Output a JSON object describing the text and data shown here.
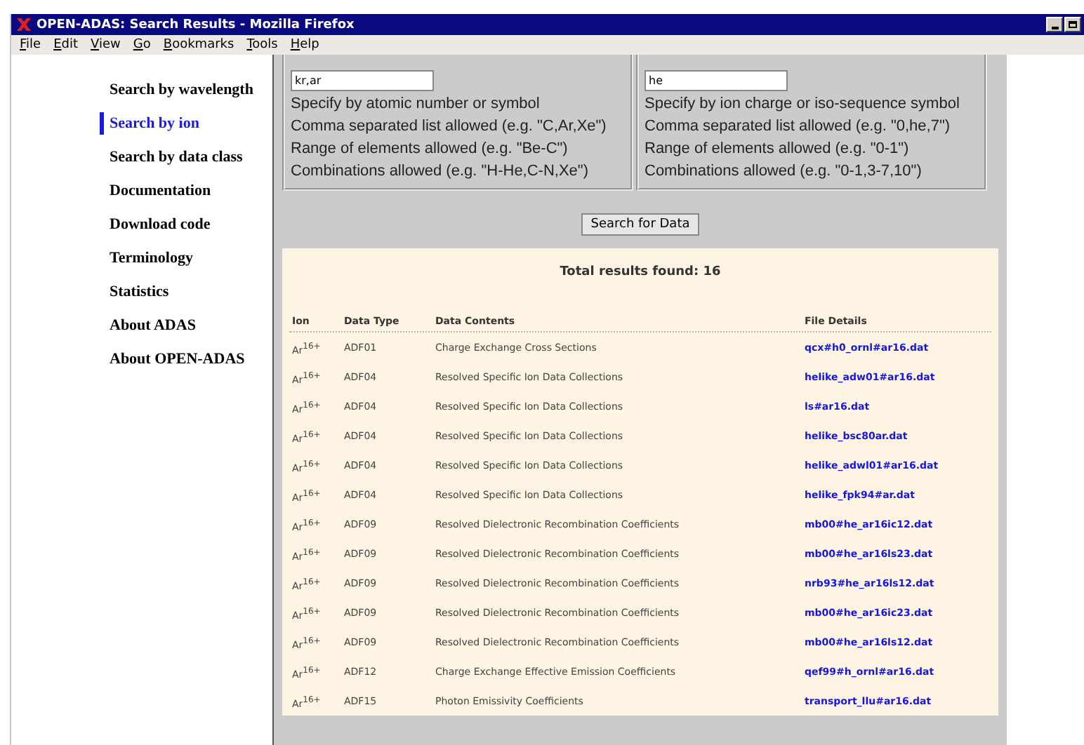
{
  "window": {
    "title": "OPEN-ADAS: Search Results - Mozilla Firefox"
  },
  "menu": [
    "File",
    "Edit",
    "View",
    "Go",
    "Bookmarks",
    "Tools",
    "Help"
  ],
  "sidebar": {
    "items": [
      {
        "label": "Search by wavelength",
        "selected": false
      },
      {
        "label": "Search by ion",
        "selected": true
      },
      {
        "label": "Search by data class",
        "selected": false
      },
      {
        "label": "Documentation",
        "selected": false
      },
      {
        "label": "Download code",
        "selected": false
      },
      {
        "label": "Terminology",
        "selected": false
      },
      {
        "label": "Statistics",
        "selected": false
      },
      {
        "label": "About ADAS",
        "selected": false
      },
      {
        "label": "About OPEN-ADAS",
        "selected": false
      }
    ]
  },
  "search_form": {
    "groups": [
      {
        "value": "kr,ar",
        "hints": [
          "Specify by atomic number or symbol",
          "Comma separated list allowed (e.g. \"C,Ar,Xe\")",
          "Range of elements allowed (e.g. \"Be-C\")",
          "Combinations allowed (e.g. \"H-He,C-N,Xe\")"
        ]
      },
      {
        "value": "he",
        "hints": [
          "Specify by ion charge or iso-sequence symbol",
          "Comma separated list allowed (e.g. \"0,he,7\")",
          "Range of elements allowed (e.g. \"0-1\")",
          "Combinations allowed (e.g. \"0-1,3-7,10\")"
        ]
      }
    ],
    "button": "Search for Data"
  },
  "results": {
    "total": "Total results found: 16",
    "columns": [
      "Ion",
      "Data Type",
      "Data Contents",
      "File Details"
    ],
    "rows": [
      {
        "ion": "Ar$^{16+}$",
        "data_type": "ADF01",
        "contents": "Charge Exchange Cross Sections",
        "file": "qcx#h0_ornl#ar16.dat"
      },
      {
        "ion": "Ar$^{16+}$",
        "data_type": "ADF04",
        "contents": "Resolved Specific Ion Data Collections",
        "file": "helike_adw01#ar16.dat"
      },
      {
        "ion": "Ar$^{16+}$",
        "data_type": "ADF04",
        "contents": "Resolved Specific Ion Data Collections",
        "file": "ls#ar16.dat"
      },
      {
        "ion": "Ar$^{16+}$",
        "data_type": "ADF04",
        "contents": "Resolved Specific Ion Data Collections",
        "file": "helike_bsc80ar.dat"
      },
      {
        "ion": "Ar$^{16+}$",
        "data_type": "ADF04",
        "contents": "Resolved Specific Ion Data Collections",
        "file": "helike_adwl01#ar16.dat"
      },
      {
        "ion": "Ar$^{16+}$",
        "data_type": "ADF04",
        "contents": "Resolved Specific Ion Data Collections",
        "file": "helike_fpk94#ar.dat"
      },
      {
        "ion": "Ar$^{16+}$",
        "data_type": "ADF09",
        "contents": "Resolved Dielectronic Recombination Coefficients",
        "file": "mb00#he_ar16ic12.dat"
      },
      {
        "ion": "Ar$^{16+}$",
        "data_type": "ADF09",
        "contents": "Resolved Dielectronic Recombination Coefficients",
        "file": "mb00#he_ar16ls23.dat"
      },
      {
        "ion": "Ar$^{16+}$",
        "data_type": "ADF09",
        "contents": "Resolved Dielectronic Recombination Coefficients",
        "file": "nrb93#he_ar16ls12.dat"
      },
      {
        "ion": "Ar$^{16+}$",
        "data_type": "ADF09",
        "contents": "Resolved Dielectronic Recombination Coefficients",
        "file": "mb00#he_ar16ic23.dat"
      },
      {
        "ion": "Ar$^{16+}$",
        "data_type": "ADF09",
        "contents": "Resolved Dielectronic Recombination Coefficients",
        "file": "mb00#he_ar16ls12.dat"
      },
      {
        "ion": "Ar$^{16+}$",
        "data_type": "ADF12",
        "contents": "Charge Exchange Effective Emission Coefficients",
        "file": "qef99#h_ornl#ar16.dat"
      },
      {
        "ion": "Ar$^{16+}$",
        "data_type": "ADF15",
        "contents": "Photon Emissivity Coefficients",
        "file": "transport_llu#ar16.dat"
      }
    ]
  }
}
